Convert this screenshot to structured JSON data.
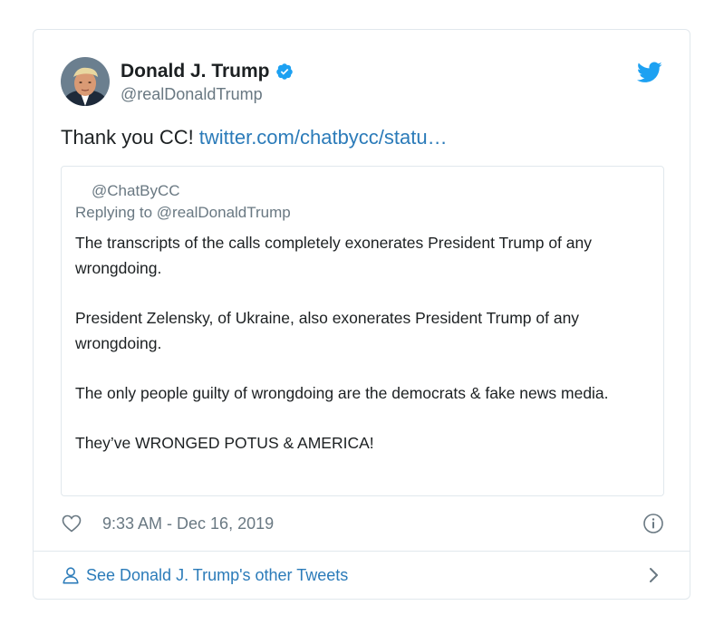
{
  "author": {
    "display_name": "Donald J. Trump",
    "handle": "@realDonaldTrump",
    "verified": true
  },
  "tweet": {
    "text": "Thank you CC!",
    "link_text": "twitter.com/chatbycc/statu…"
  },
  "quoted_tweet": {
    "handle": "@ChatByCC",
    "replying_to": "Replying to @realDonaldTrump",
    "paragraphs": [
      "The transcripts of the calls completely exonerates President Trump of any wrongdoing.",
      "President Zelensky, of Ukraine, also exonerates President Trump of any wrongdoing.",
      "The only people guilty of wrongdoing are the democrats & fake news media.",
      "They’ve WRONGED POTUS & AMERICA!"
    ]
  },
  "meta": {
    "timestamp": "9:33 AM - Dec 16, 2019"
  },
  "footer": {
    "link_text": "See Donald J. Trump's other Tweets"
  },
  "icons": {
    "verified": "verified-badge-icon",
    "brand": "twitter-bird-icon",
    "like": "heart-icon",
    "info": "info-icon",
    "profile": "person-icon",
    "chevron": "chevron-right-icon"
  },
  "colors": {
    "link": "#2b7bb9",
    "brand": "#1da1f2",
    "secondary_text": "#697882",
    "border": "#e1e8ed"
  }
}
